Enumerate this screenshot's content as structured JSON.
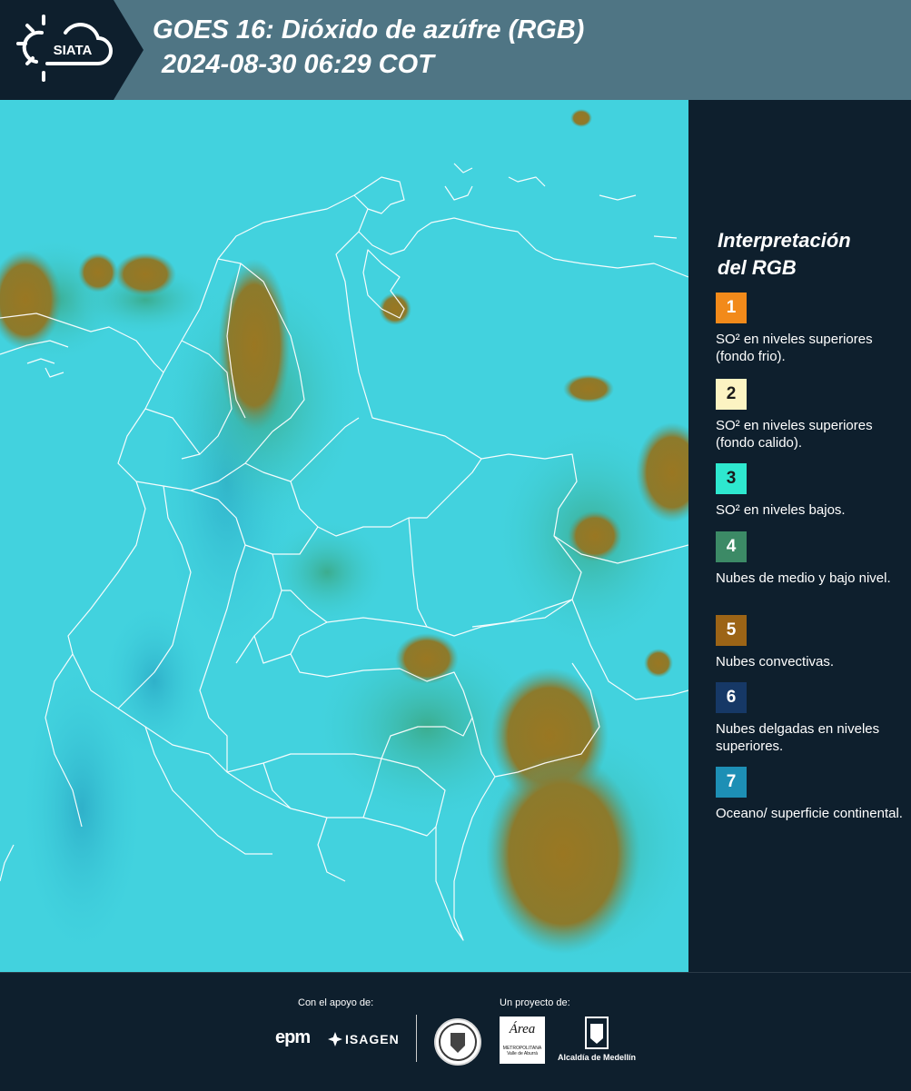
{
  "header": {
    "logo_text": "SIATA",
    "title_line1": "GOES 16: Dióxido de azúfre (RGB)",
    "title_line2": "2024-08-30 06:29 COT",
    "background_color": "#4f7584"
  },
  "map": {
    "background_color": "#3fd3df",
    "land_border_color": "#ffffff",
    "cloud_color": "#a07a28"
  },
  "legend": {
    "title_line1": "Interpretación",
    "title_line2": "del RGB",
    "items": [
      {
        "number": "1",
        "color": "#f28a1a",
        "text": "SO² en niveles superiores (fondo frio)."
      },
      {
        "number": "2",
        "color": "#fcf3c2",
        "text": "SO² en niveles superiores (fondo calido)."
      },
      {
        "number": "3",
        "color": "#2ee8cf",
        "text": "SO² en niveles bajos."
      },
      {
        "number": "4",
        "color": "#3c8a66",
        "text": "Nubes de medio y bajo nivel."
      },
      {
        "number": "5",
        "color": "#9c6416",
        "text": "Nubes convectivas."
      },
      {
        "number": "6",
        "color": "#163866",
        "text": "Nubes delgadas en niveles superiores."
      },
      {
        "number": "7",
        "color": "#1d8fb5",
        "text": "Oceano/ superficie continental."
      }
    ]
  },
  "footer": {
    "support_label": "Con el apoyo de:",
    "project_label": "Un proyecto de:",
    "sponsor1": "epm",
    "sponsor2": "ISAGEN",
    "partner_area": "Área",
    "partner_area_sub": "METROPOLITANA Valle de Aburrá",
    "partner_alcaldia": "Alcaldía de Medellín"
  }
}
